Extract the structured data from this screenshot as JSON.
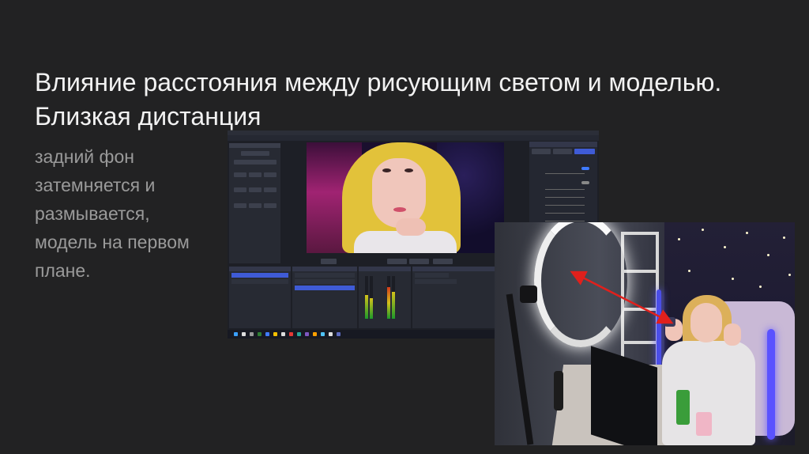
{
  "slide": {
    "title": "Влияние расстояния между рисующим светом и моделью. Близкая дистанция",
    "body_text": "задний фон затемняется и размывается, модель на первом плане."
  },
  "colors": {
    "background": "#222223",
    "title": "#f2f2f2",
    "body_text": "#9a9a9a",
    "obs_accent": "#3f5bd6",
    "arrow": "#e0201c"
  },
  "obs_screenshot": {
    "description_icon": "obs-window-icon",
    "menu_icons": [
      "menu-item",
      "menu-item",
      "menu-item",
      "menu-item",
      "menu-item",
      "menu-item",
      "menu-item",
      "menu-item"
    ]
  },
  "photo": {
    "icon": "studio-photo-icon"
  }
}
